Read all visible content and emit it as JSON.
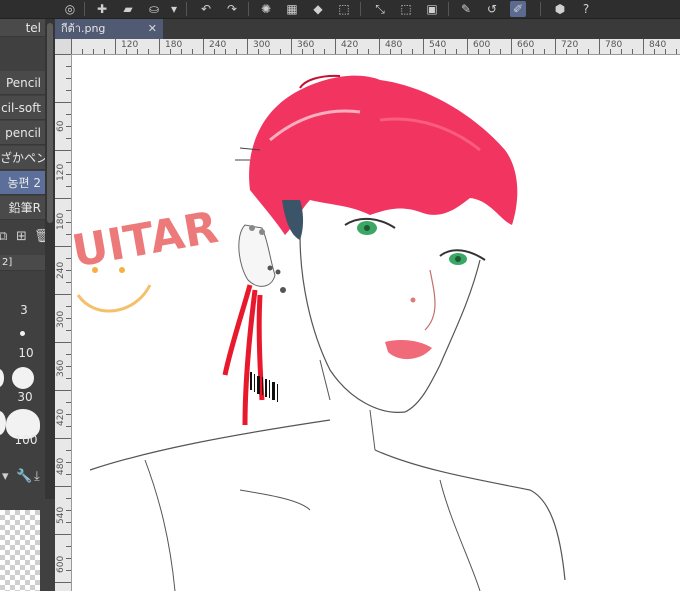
{
  "document_tab": {
    "name": "กีต้า.png",
    "close": "✕"
  },
  "toolbar": {
    "icons": [
      "quick-access-icon",
      "new-icon",
      "open-icon",
      "save-icon",
      "dropdown-icon",
      "undo-icon",
      "redo-icon",
      "busy-icon",
      "fill-icon",
      "transform-icon",
      "cut-icon",
      "selection-icon",
      "deselect-icon",
      "pen-icon",
      "eraser-icon",
      "ruler-icon",
      "help-icon"
    ]
  },
  "brushes": [
    {
      "label": "Pencil"
    },
    {
      "label": "cil-soft"
    },
    {
      "label": "pencil"
    },
    {
      "label": "ざかペン"
    },
    {
      "label": "농편 2"
    },
    {
      "label": "鉛筆R"
    }
  ],
  "panel_header": "tel",
  "panel_footer_label": "2]",
  "brush_sizes": [
    "3",
    "10",
    "30",
    "100"
  ],
  "ruler_top": [
    "120",
    "180",
    "240",
    "300",
    "360",
    "420",
    "480",
    "540",
    "600",
    "660",
    "720",
    "780",
    "840",
    "900"
  ],
  "ruler_left": [
    "60",
    "120",
    "180",
    "240",
    "300",
    "360",
    "420",
    "480",
    "540",
    "600",
    "660"
  ],
  "artwork": {
    "text": "UITAR"
  },
  "colors": {
    "accent": "#5b6f9a",
    "hair": "#ef1f4f",
    "eyes": "#3aa864"
  }
}
